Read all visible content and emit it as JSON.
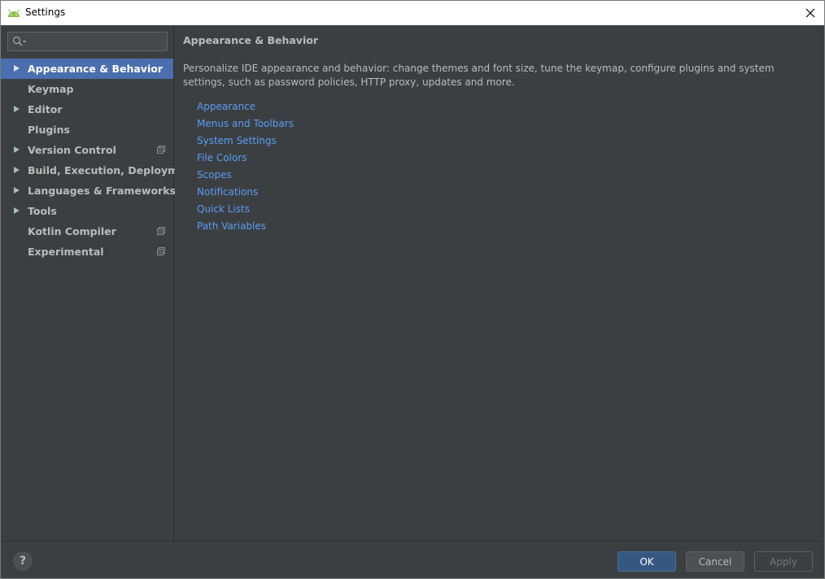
{
  "window": {
    "title": "Settings"
  },
  "search": {
    "placeholder": ""
  },
  "sidebar": {
    "items": [
      {
        "label": "Appearance & Behavior",
        "expandable": true,
        "selected": true,
        "project_icon": false
      },
      {
        "label": "Keymap",
        "expandable": false,
        "selected": false,
        "project_icon": false
      },
      {
        "label": "Editor",
        "expandable": true,
        "selected": false,
        "project_icon": false
      },
      {
        "label": "Plugins",
        "expandable": false,
        "selected": false,
        "project_icon": false
      },
      {
        "label": "Version Control",
        "expandable": true,
        "selected": false,
        "project_icon": true
      },
      {
        "label": "Build, Execution, Deployment",
        "expandable": true,
        "selected": false,
        "project_icon": false
      },
      {
        "label": "Languages & Frameworks",
        "expandable": true,
        "selected": false,
        "project_icon": false
      },
      {
        "label": "Tools",
        "expandable": true,
        "selected": false,
        "project_icon": false
      },
      {
        "label": "Kotlin Compiler",
        "expandable": false,
        "selected": false,
        "project_icon": true
      },
      {
        "label": "Experimental",
        "expandable": false,
        "selected": false,
        "project_icon": true
      }
    ]
  },
  "main": {
    "title": "Appearance & Behavior",
    "description": "Personalize IDE appearance and behavior: change themes and font size, tune the keymap, configure plugins and system settings, such as password policies, HTTP proxy, updates and more.",
    "links": [
      "Appearance",
      "Menus and Toolbars",
      "System Settings",
      "File Colors",
      "Scopes",
      "Notifications",
      "Quick Lists",
      "Path Variables"
    ]
  },
  "footer": {
    "help_label": "?",
    "ok_label": "OK",
    "cancel_label": "Cancel",
    "apply_label": "Apply"
  },
  "icons": {
    "app": "android-icon",
    "close": "close-icon",
    "search": "search-icon",
    "expand": "chevron-right-icon",
    "project": "project-settings-icon"
  },
  "colors": {
    "accent_selected": "#4b6eaf",
    "link": "#589df6",
    "ok_button": "#365880",
    "background": "#3c3f41"
  }
}
